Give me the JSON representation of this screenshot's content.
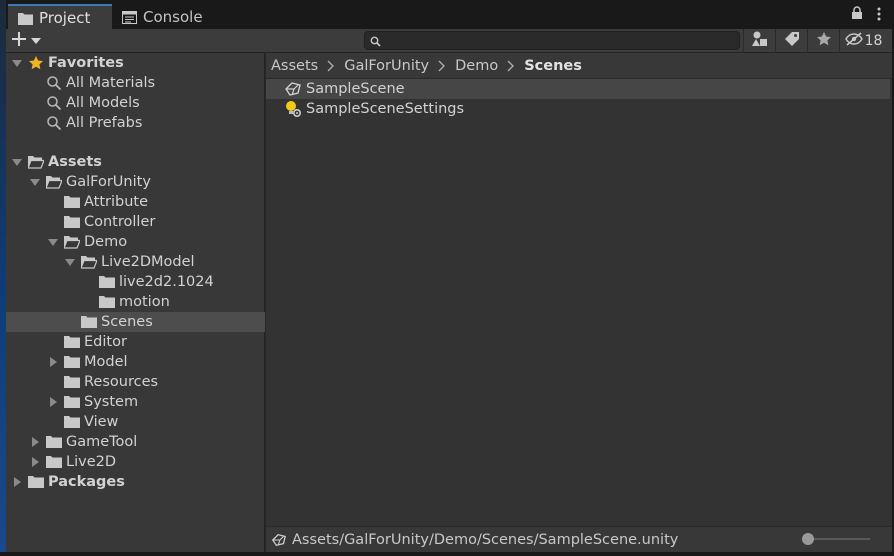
{
  "tabs": [
    {
      "label": "Project",
      "icon": "folder-icon",
      "active": true
    },
    {
      "label": "Console",
      "icon": "console-icon",
      "active": false
    }
  ],
  "toolbar": {
    "add_icon": "plus-icon",
    "search_placeholder": "",
    "hidden_count": "18"
  },
  "tree": {
    "favorites": {
      "label": "Favorites",
      "items": [
        "All Materials",
        "All Models",
        "All Prefabs"
      ]
    },
    "assets_label": "Assets",
    "nodes": [
      {
        "label": "GalForUnity"
      },
      {
        "label": "Attribute"
      },
      {
        "label": "Controller"
      },
      {
        "label": "Demo"
      },
      {
        "label": "Live2DModel"
      },
      {
        "label": "live2d2.1024"
      },
      {
        "label": "motion"
      },
      {
        "label": "Scenes"
      },
      {
        "label": "Editor"
      },
      {
        "label": "Model"
      },
      {
        "label": "Resources"
      },
      {
        "label": "System"
      },
      {
        "label": "View"
      },
      {
        "label": "GameTool"
      },
      {
        "label": "Live2D"
      }
    ],
    "packages_label": "Packages"
  },
  "breadcrumb": [
    "Assets",
    "GalForUnity",
    "Demo",
    "Scenes"
  ],
  "items": [
    {
      "label": "SampleScene",
      "icon": "unity-scene-icon"
    },
    {
      "label": "SampleSceneSettings",
      "icon": "lighting-settings-icon"
    }
  ],
  "status": {
    "path": "Assets/GalForUnity/Demo/Scenes/SampleScene.unity"
  },
  "colors": {
    "accent": "#3a79bb",
    "star": "#f0b323"
  }
}
